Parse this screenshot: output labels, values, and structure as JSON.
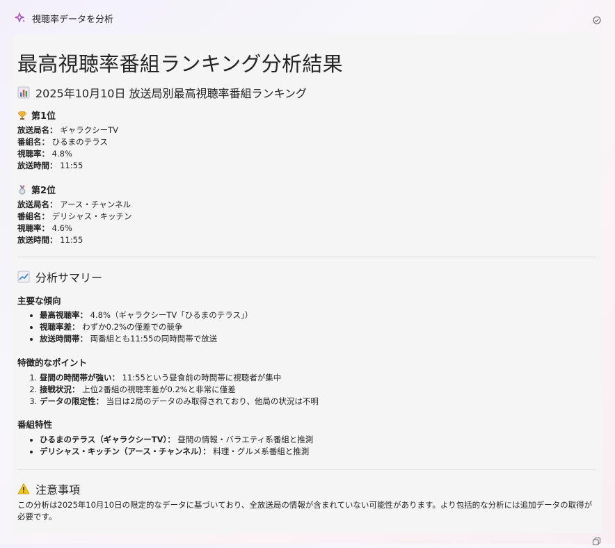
{
  "app": {
    "title": "視聴率データを分析"
  },
  "doc": {
    "title": "最高視聴率番組ランキング分析結果",
    "ranking_heading": "2025年10月10日 放送局別最高視聴率番組ランキング",
    "rank1": {
      "heading": "第1位",
      "station_label": "放送局名：",
      "station": "ギャラクシーTV",
      "program_label": "番組名：",
      "program": "ひるまのテラス",
      "rating_label": "視聴率：",
      "rating": "4.8%",
      "time_label": "放送時間：",
      "time": "11:55"
    },
    "rank2": {
      "heading": "第2位",
      "station_label": "放送局名：",
      "station": "アース・チャンネル",
      "program_label": "番組名：",
      "program": "デリシャス・キッチン",
      "rating_label": "視聴率：",
      "rating": "4.6%",
      "time_label": "放送時間：",
      "time": "11:55"
    },
    "summary_heading": "分析サマリー",
    "trends_heading": "主要な傾向",
    "trends": [
      {
        "label": "最高視聴率：",
        "text": "4.8%（ギャラクシーTV「ひるまのテラス」）"
      },
      {
        "label": "視聴率差：",
        "text": "わずか0.2%の僅差での競争"
      },
      {
        "label": "放送時間帯：",
        "text": "両番組とも11:55の同時間帯で放送"
      }
    ],
    "points_heading": "特徴的なポイント",
    "points": [
      {
        "label": "昼間の時間帯が強い：",
        "text": "11:55という昼食前の時間帯に視聴者が集中"
      },
      {
        "label": "接戦状況：",
        "text": "上位2番組の視聴率差が0.2%と非常に僅差"
      },
      {
        "label": "データの限定性：",
        "text": "当日は2局のデータのみ取得されており、他局の状況は不明"
      }
    ],
    "traits_heading": "番組特性",
    "traits": [
      {
        "label": "ひるまのテラス（ギャラクシーTV）：",
        "text": "昼間の情報・バラエティ系番組と推測"
      },
      {
        "label": "デリシャス・キッチン（アース・チャンネル）：",
        "text": "料理・グルメ系番組と推測"
      }
    ],
    "caution_heading": "注意事項",
    "caution_text": "この分析は2025年10月10日の限定的なデータに基づいており、全放送局の情報が含まれていない可能性があります。より包括的な分析には追加データの取得が必要です。"
  },
  "colors": {
    "background": "#f5f5f5",
    "accent": "#8a56d6"
  },
  "icons": [
    "sparkle-icon",
    "status-icon",
    "bar-chart-icon",
    "trophy-icon",
    "medal-icon",
    "trend-chart-icon",
    "warning-icon",
    "copy-icon"
  ]
}
